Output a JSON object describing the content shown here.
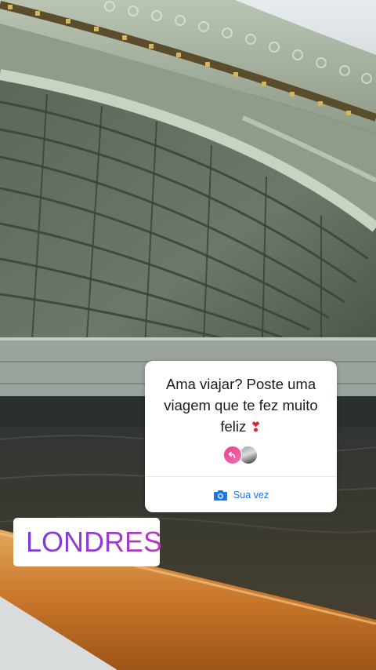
{
  "question_sticker": {
    "question": "Ama viajar? Poste uma viagem que te fez muito feliz",
    "emoji": "❣",
    "action_label": "Sua vez",
    "action_icon": "camera-icon",
    "responder_avatars": [
      "avatar-reply",
      "avatar-photo"
    ]
  },
  "location_sticker": {
    "icon": "location-pin-icon",
    "label": "LONDRES"
  },
  "colors": {
    "action_blue": "#1877f2",
    "location_gradient_start": "#7a3bd8",
    "location_gradient_end": "#b73bb5",
    "emoji_red": "#e2223a"
  }
}
